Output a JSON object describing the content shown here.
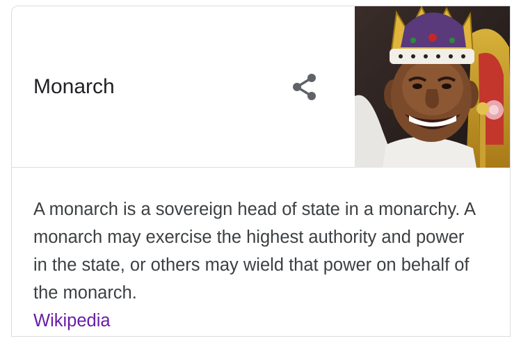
{
  "knowledge_panel": {
    "title": "Monarch",
    "description": "A monarch is a sovereign head of state in a monarchy. A monarch may exercise the highest authority and power in the state, or others may wield that power on behalf of the monarch.",
    "source_link": "Wikipedia",
    "share_icon": "share-icon",
    "thumbnail_icon": "caricature-king-image",
    "colors": {
      "title": "#202124",
      "body": "#3c4043",
      "link": "#681da8",
      "divider": "#dadce0",
      "share": "#5f6368"
    }
  }
}
